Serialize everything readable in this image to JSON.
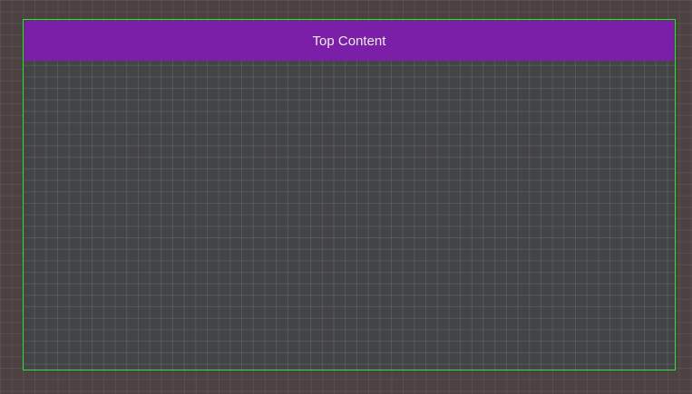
{
  "top_bar": {
    "label": "Top Content",
    "background_color": "#7b1fa8",
    "text_color": "#ececec"
  },
  "frame": {
    "border_color": "#29e23a",
    "background_color": "#434446"
  },
  "canvas": {
    "background_color": "#4d4142",
    "grid": true
  }
}
